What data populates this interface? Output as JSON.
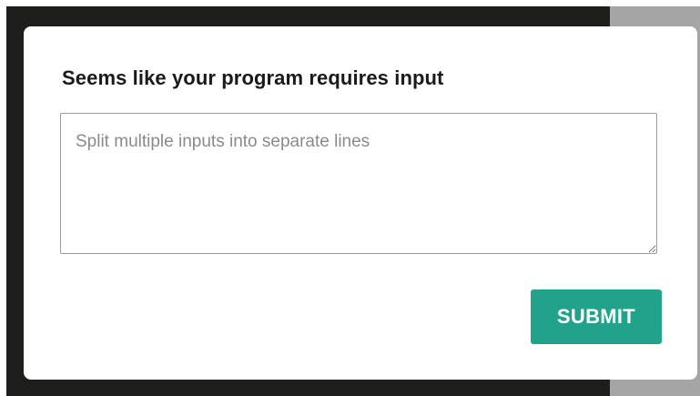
{
  "dialog": {
    "title": "Seems like your program requires input",
    "input": {
      "value": "",
      "placeholder": "Split multiple inputs into separate lines"
    },
    "submit_label": "SUBMIT"
  },
  "colors": {
    "backdrop_dark": "#1e1f1c",
    "backdrop_gray": "#a5a5a5",
    "modal_background": "#ffffff",
    "submit_button": "#20a38a",
    "submit_text": "#ffffff",
    "input_border": "#9a9a9a",
    "placeholder_text": "#8a8a8a"
  }
}
